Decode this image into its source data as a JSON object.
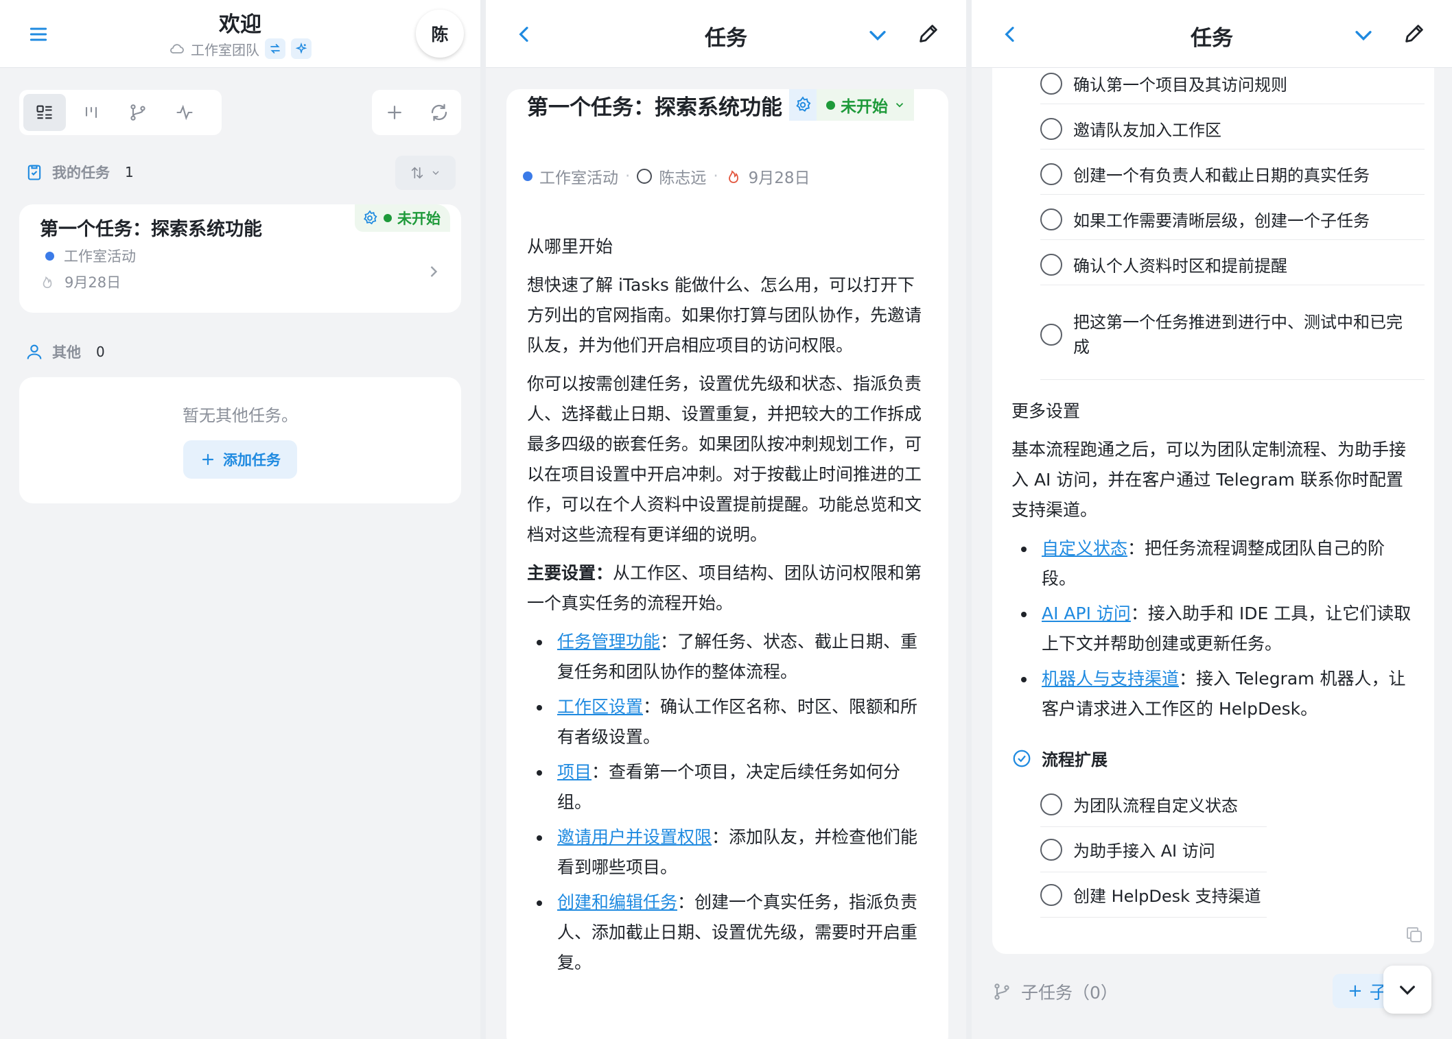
{
  "left": {
    "title": "欢迎",
    "workspace": "工作室团队",
    "avatar": "陈",
    "my_tasks": {
      "label": "我的任务",
      "count": "1"
    },
    "task": {
      "title": "第一个任务：探索系统功能",
      "status": "未开始",
      "project": "工作室活动",
      "date": "9月28日"
    },
    "others": {
      "label": "其他",
      "count": "0",
      "empty": "暂无其他任务。",
      "add": "添加任务"
    }
  },
  "middle": {
    "header_title": "任务",
    "task_title": "第一个任务：探索系统功能",
    "status": "未开始",
    "project": "工作室活动",
    "assignee": "陈志远",
    "due": "9月28日",
    "heading": "从哪里开始",
    "para1": "想快速了解 iTasks 能做什么、怎么用，可以打开下方列出的官网指南。如果你打算与团队协作，先邀请队友，并为他们开启相应项目的访问权限。",
    "para2": "你可以按需创建任务，设置优先级和状态、指派负责人、选择截止日期、设置重复，并把较大的工作拆成最多四级的嵌套任务。如果团队按冲刺规划工作，可以在项目设置中开启冲刺。对于按截止时间推进的工作，可以在个人资料中设置提前提醒。功能总览和文档对这些流程有更详细的说明。",
    "main_bold": "主要设置：",
    "main_text": "从工作区、项目结构、团队访问权限和第一个真实任务的流程开始。",
    "links": [
      {
        "link": "任务管理功能",
        "text": "：了解任务、状态、截止日期、重复任务和团队协作的整体流程。"
      },
      {
        "link": "工作区设置",
        "text": "：确认工作区名称、时区、限额和所有者级设置。"
      },
      {
        "link": "项目",
        "text": "：查看第一个项目，决定后续任务如何分组。"
      },
      {
        "link": "邀请用户并设置权限",
        "text": "：添加队友，并检查他们能看到哪些项目。"
      },
      {
        "link": "创建和编辑任务",
        "text": "：创建一个真实任务，指派负责人、添加截止日期、设置优先级，需要时开启重复。"
      }
    ]
  },
  "right": {
    "header_title": "任务",
    "checklist1": [
      "确认第一个项目及其访问规则",
      "邀请队友加入工作区",
      "创建一个有负责人和截止日期的真实任务",
      "如果工作需要清晰层级，创建一个子任务",
      "确认个人资料时区和提前提醒",
      "把这第一个任务推进到进行中、测试中和已完成"
    ],
    "heading": "更多设置",
    "para": "基本流程跑通之后，可以为团队定制流程、为助手接入 AI 访问，并在客户通过 Telegram 联系你时配置支持渠道。",
    "links": [
      {
        "link": "自定义状态",
        "text": "：把任务流程调整成团队自己的阶段。"
      },
      {
        "link": "AI API 访问",
        "text": "：接入助手和 IDE 工具，让它们读取上下文并帮助创建或更新任务。"
      },
      {
        "link": "机器人与支持渠道",
        "text": "：接入 Telegram 机器人，让客户请求进入工作区的 HelpDesk。"
      }
    ],
    "section2": "流程扩展",
    "checklist2": [
      "为团队流程自定义状态",
      "为助手接入 AI 访问",
      "创建 HelpDesk 支持渠道"
    ],
    "subtasks": "子任务（0）",
    "add_sub": "子"
  },
  "colors": {
    "accent": "#1f8ae0",
    "status_green": "#1e9a3a",
    "project_dot": "#3b7be8",
    "flame": "#e2553d"
  }
}
